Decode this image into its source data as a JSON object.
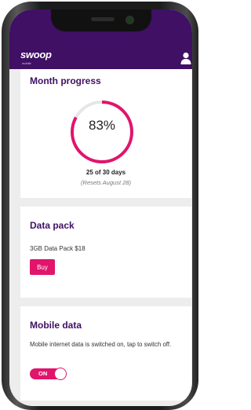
{
  "app": {
    "logo": "swoop",
    "logo_sub": "mobile"
  },
  "icons": {
    "user": "user-icon"
  },
  "colors": {
    "brand": "#3f1063",
    "accent": "#e0156b",
    "background": "#ededed"
  },
  "month_progress": {
    "title": "Month progress",
    "percent_label": "83%",
    "percent": 0.83,
    "days_label": "25 of 30 days",
    "resets_label": "(Resets August 28)"
  },
  "data_pack": {
    "title": "Data pack",
    "pack_name": "3GB Data Pack $18",
    "buy_label": "Buy"
  },
  "mobile_data": {
    "title": "Mobile data",
    "description": "Mobile internet data is switched on, tap to switch off.",
    "toggle_label": "ON",
    "toggle_on": true
  }
}
